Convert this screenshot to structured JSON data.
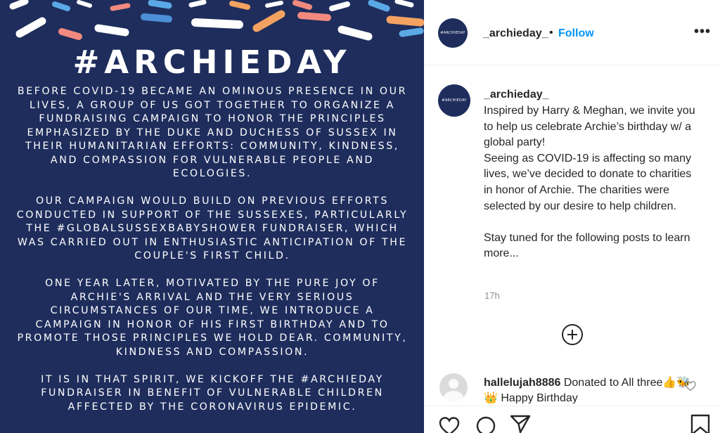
{
  "post_image": {
    "heading": "#ARCHIEDAY",
    "paragraphs": [
      "BEFORE COVID-19 BECAME AN OMINOUS PRESENCE IN OUR LIVES, A GROUP OF US GOT TOGETHER TO ORGANIZE A FUNDRAISING CAMPAIGN TO HONOR THE PRINCIPLES EMPHASIZED BY THE DUKE AND DUCHESS OF SUSSEX IN THEIR HUMANITARIAN EFFORTS: COMMUNITY, KINDNESS, AND COMPASSION FOR VULNERABLE PEOPLE AND ECOLOGIES.",
      "OUR CAMPAIGN WOULD BUILD ON PREVIOUS EFFORTS CONDUCTED IN SUPPORT OF THE SUSSEXES, PARTICULARLY THE #GLOBALSUSSEXBABYSHOWER FUNDRAISER, WHICH WAS CARRIED OUT IN ENTHUSIASTIC ANTICIPATION OF THE COUPLE'S FIRST CHILD.",
      "ONE YEAR LATER, MOTIVATED BY THE PURE JOY OF ARCHIE'S ARRIVAL AND THE VERY SERIOUS CIRCUMSTANCES OF OUR TIME, WE INTRODUCE A CAMPAIGN IN HONOR OF HIS FIRST BIRTHDAY AND TO PROMOTE THOSE PRINCIPLES WE HOLD DEAR. COMMUNITY, KINDNESS AND COMPASSION.",
      "IT IS IN THAT SPIRIT, WE KICKOFF THE #ARCHIEDAY FUNDRAISER IN BENEFIT OF VULNERABLE CHILDREN AFFECTED BY THE CORONAVIRUS EPIDEMIC."
    ],
    "colors": {
      "background": "#1e2d5c",
      "stroke_colors": [
        "#ffffff",
        "#5aa9e6",
        "#f4a261",
        "#f08a7e",
        "#4c8fd6"
      ]
    }
  },
  "header": {
    "avatar_text": "#ARCHIEDAY",
    "username": "_archieday_",
    "separator": "•",
    "follow_label": "Follow",
    "more_icon": "more-horizontal-icon"
  },
  "caption": {
    "avatar_text": "#ARCHIEDAY",
    "username": "_archieday_",
    "line1": "Inspired by Harry & Meghan, we invite you to help us celebrate Archie’s birthday w/ a global party!",
    "line2": "Seeing as COVID-19 is affecting so many lives, we’ve decided to donate to charities in honor of Archie. The charities were selected by our desire to help children.",
    "line3": "Stay tuned for the following posts to learn more...",
    "timestamp": "17h"
  },
  "load_more_icon": "plus-circle-icon",
  "comment": {
    "username": "hallelujah8886",
    "text": " Donated to All three👍🐝👑 Happy Birthday",
    "like_icon": "heart-outline-icon"
  },
  "actions": {
    "icons": [
      "heart-icon",
      "comment-icon",
      "share-icon",
      "bookmark-icon"
    ]
  },
  "colors": {
    "link_blue": "#0095f6",
    "text_dark": "#262626",
    "text_muted": "#8e8e8e",
    "divider": "#efefef"
  }
}
